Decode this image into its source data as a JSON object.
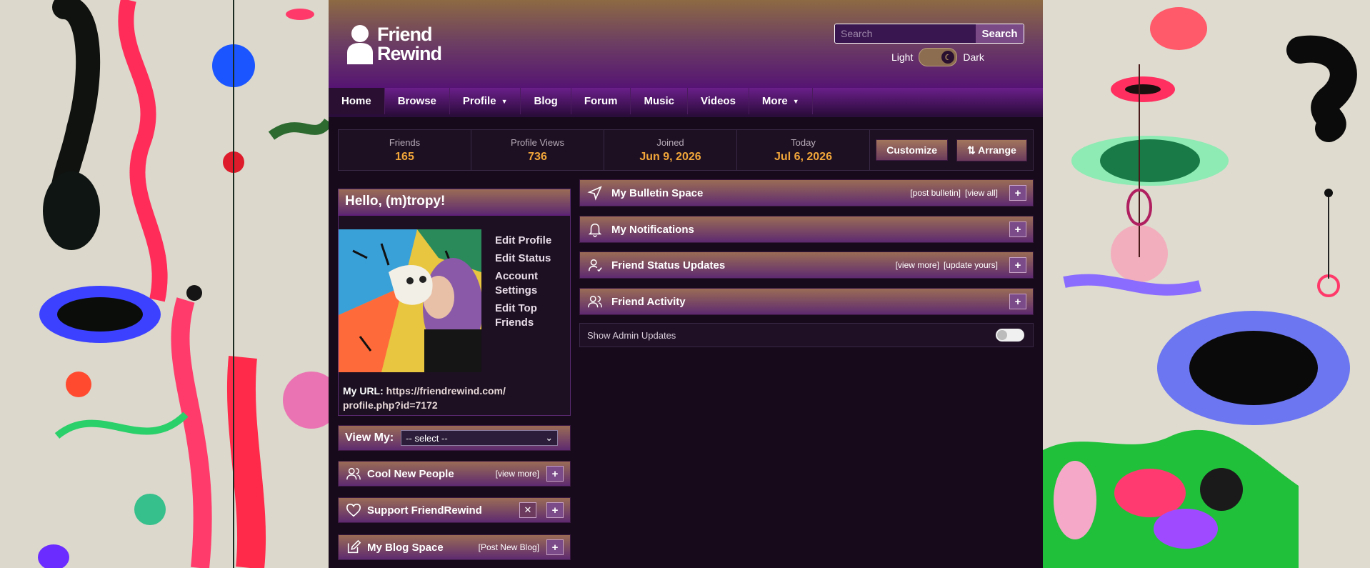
{
  "header": {
    "logo_text": "Friend\nRewind",
    "search": {
      "placeholder": "Search",
      "button_label": "Search"
    },
    "theme": {
      "light_label": "Light",
      "dark_label": "Dark",
      "mode": "dark"
    }
  },
  "nav": {
    "items": [
      {
        "label": "Home",
        "active": true,
        "dropdown": false
      },
      {
        "label": "Browse",
        "active": false,
        "dropdown": false
      },
      {
        "label": "Profile",
        "active": false,
        "dropdown": true
      },
      {
        "label": "Blog",
        "active": false,
        "dropdown": false
      },
      {
        "label": "Forum",
        "active": false,
        "dropdown": false
      },
      {
        "label": "Music",
        "active": false,
        "dropdown": false
      },
      {
        "label": "Videos",
        "active": false,
        "dropdown": false
      },
      {
        "label": "More",
        "active": false,
        "dropdown": true
      }
    ],
    "caret": "▼"
  },
  "stats": {
    "items": [
      {
        "label": "Friends",
        "value": "165"
      },
      {
        "label": "Profile Views",
        "value": "736"
      },
      {
        "label": "Joined",
        "value": "Jun 9, 2026"
      },
      {
        "label": "Today",
        "value": "Jul 6, 2026"
      }
    ],
    "customize_label": "Customize",
    "arrange_label": "⇅ Arrange"
  },
  "profile": {
    "greeting": "Hello, (m)tropy!",
    "links": [
      "Edit Profile",
      "Edit Status",
      "Account Settings",
      "Edit Top Friends"
    ],
    "url_label": "My URL:",
    "url": "https://friendrewind.com/ profile.php?id=7172"
  },
  "view_my": {
    "label": "View My:",
    "selected": "-- select --"
  },
  "side_panels": {
    "cool_new_people": {
      "title": "Cool New People",
      "link": "[view more]"
    },
    "support": {
      "title": "Support FriendRewind",
      "close": "✕"
    },
    "blog_space": {
      "title": "My Blog Space",
      "link": "[Post New Blog]"
    }
  },
  "main_panels": {
    "bulletin": {
      "title": "My Bulletin Space",
      "links": [
        "[post bulletin]",
        "[view all]"
      ]
    },
    "notifications": {
      "title": "My Notifications"
    },
    "status_updates": {
      "title": "Friend Status Updates",
      "links": [
        "[view more]",
        "[update yours]"
      ]
    },
    "activity": {
      "title": "Friend Activity"
    }
  },
  "admin": {
    "label": "Show Admin Updates",
    "enabled": false
  },
  "plus_label": "+"
}
